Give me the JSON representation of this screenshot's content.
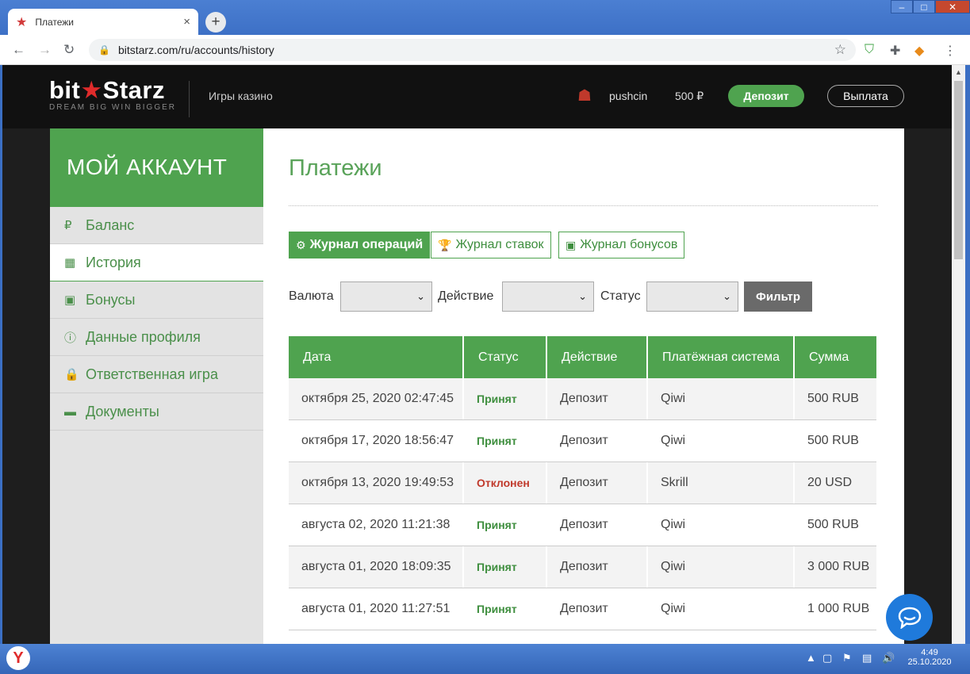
{
  "browser": {
    "tab_title": "Платежи",
    "url": "bitstarz.com/ru/accounts/history"
  },
  "header": {
    "logo_main_left": "bit",
    "logo_main_right": "Starz",
    "logo_tagline": "DREAM BIG  WIN BIGGER",
    "nav_link": "Игры казино",
    "username": "pushcin",
    "balance": "500 ₽",
    "deposit_label": "Депозит",
    "withdraw_label": "Выплата"
  },
  "sidebar": {
    "title": "МОЙ АККАУНТ",
    "items": [
      {
        "label": "Баланс",
        "icon": "ruble-icon"
      },
      {
        "label": "История",
        "icon": "calendar-icon"
      },
      {
        "label": "Бонусы",
        "icon": "gift-icon"
      },
      {
        "label": "Данные профиля",
        "icon": "info-icon"
      },
      {
        "label": "Ответственная игра",
        "icon": "lock-icon"
      },
      {
        "label": "Документы",
        "icon": "folder-icon"
      }
    ]
  },
  "main": {
    "title": "Платежи",
    "tabs": [
      {
        "label": "Журнал операций",
        "icon": "gear-icon"
      },
      {
        "label": "Журнал ставок",
        "icon": "trophy-icon"
      },
      {
        "label": "Журнал бонусов",
        "icon": "gift-icon"
      }
    ],
    "filters": {
      "currency_label": "Валюта",
      "action_label": "Действие",
      "status_label": "Статус",
      "filter_button": "Фильтр"
    },
    "table": {
      "columns": [
        "Дата",
        "Статус",
        "Действие",
        "Платёжная система",
        "Сумма"
      ],
      "rows": [
        {
          "date": "октября 25, 2020 02:47:45",
          "status": "Принят",
          "action": "Депозит",
          "system": "Qiwi",
          "amount": "500 RUB"
        },
        {
          "date": "октября 17, 2020 18:56:47",
          "status": "Принят",
          "action": "Депозит",
          "system": "Qiwi",
          "amount": "500 RUB"
        },
        {
          "date": "октября 13, 2020 19:49:53",
          "status": "Отклонен",
          "action": "Депозит",
          "system": "Skrill",
          "amount": "20 USD"
        },
        {
          "date": "августа 02, 2020 11:21:38",
          "status": "Принят",
          "action": "Депозит",
          "system": "Qiwi",
          "amount": "500 RUB"
        },
        {
          "date": "августа 01, 2020 18:09:35",
          "status": "Принят",
          "action": "Депозит",
          "system": "Qiwi",
          "amount": "3 000 RUB"
        },
        {
          "date": "августа 01, 2020 11:27:51",
          "status": "Принят",
          "action": "Депозит",
          "system": "Qiwi",
          "amount": "1 000 RUB"
        }
      ]
    }
  },
  "taskbar": {
    "time": "4:49",
    "date": "25.10.2020"
  },
  "colors": {
    "accent": "#4fa34f",
    "rejected": "#c0392b",
    "header_bg": "#111111"
  }
}
